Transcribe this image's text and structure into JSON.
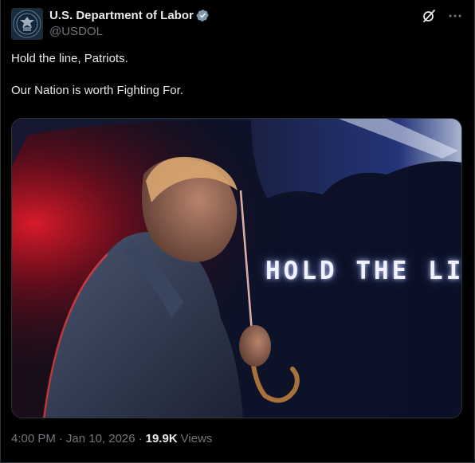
{
  "account": {
    "display_name": "U.S. Department of Labor",
    "handle": "@USDOL",
    "verified_icon": "verified-badge-icon",
    "avatar_icon": "department-of-labor-seal"
  },
  "actions": {
    "grok_icon": "grok-icon",
    "more_icon": "more-options-icon"
  },
  "post": {
    "line1": "Hold the line, Patriots.",
    "line2": "Our Nation is worth Fighting For."
  },
  "media": {
    "headline": "HOLD THE LINE."
  },
  "meta": {
    "time": "4:00 PM",
    "separator": "·",
    "date": "Jan 10, 2026",
    "views_count": "19.9K",
    "views_label": "Views"
  },
  "colors": {
    "background": "#000000",
    "text_primary": "#e7e9ea",
    "text_secondary": "#71767b",
    "verified": "#829aab"
  }
}
